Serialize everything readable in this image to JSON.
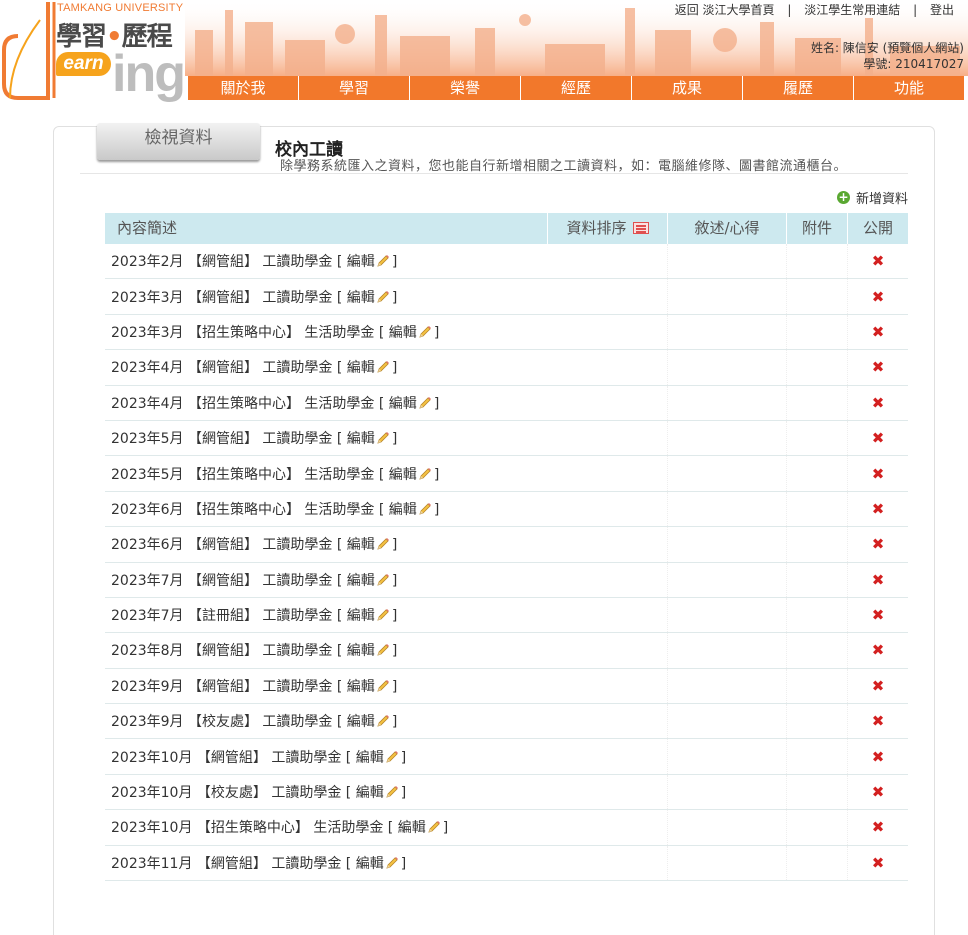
{
  "header": {
    "university": "TAMKANG UNIVERSITY",
    "logo_title_a": "學習",
    "logo_dot": "•",
    "logo_title_b": "歷程",
    "logo_earn": "earn",
    "logo_ing": "ing",
    "top_links": [
      "返回 淡江大學首頁",
      "淡江學生常用連結",
      "登出"
    ],
    "top_sep": "|",
    "user_name": "姓名: 陳信安 (預覽個人網站)",
    "student_id": "學號: 210417027"
  },
  "nav": [
    "關於我",
    "學習",
    "榮譽",
    "經歷",
    "成果",
    "履歷",
    "功能"
  ],
  "colors": {
    "accent": "#f2782b",
    "table_header": "#cde9ef",
    "delete": "#d32020",
    "add": "#5aa832"
  },
  "panel": {
    "tab_label": "檢視資料",
    "title": "校內工讀",
    "description": "除學務系統匯入之資料，您也能自行新增相關之工讀資料，如：電腦維修隊、圖書館流通櫃台。",
    "add_label": "新增資料",
    "add_icon": "plus-circle-icon"
  },
  "table": {
    "headers": [
      "內容簡述",
      "資料排序",
      "敘述/心得",
      "附件",
      "公開"
    ],
    "edit_open": "[ 編輯",
    "edit_close": "]",
    "rows": [
      "2023年2月 【網管組】 工讀助學金",
      "2023年3月 【網管組】 工讀助學金",
      "2023年3月 【招生策略中心】 生活助學金",
      "2023年4月 【網管組】 工讀助學金",
      "2023年4月 【招生策略中心】 生活助學金",
      "2023年5月 【網管組】 工讀助學金",
      "2023年5月 【招生策略中心】 生活助學金",
      "2023年6月 【招生策略中心】 生活助學金",
      "2023年6月 【網管組】 工讀助學金",
      "2023年7月 【網管組】 工讀助學金",
      "2023年7月 【註冊組】 工讀助學金",
      "2023年8月 【網管組】 工讀助學金",
      "2023年9月 【網管組】 工讀助學金",
      "2023年9月 【校友處】 工讀助學金",
      "2023年10月 【網管組】 工讀助學金",
      "2023年10月 【校友處】 工讀助學金",
      "2023年10月 【招生策略中心】 生活助學金",
      "2023年11月 【網管組】 工讀助學金"
    ],
    "delete_glyph": "✖"
  }
}
